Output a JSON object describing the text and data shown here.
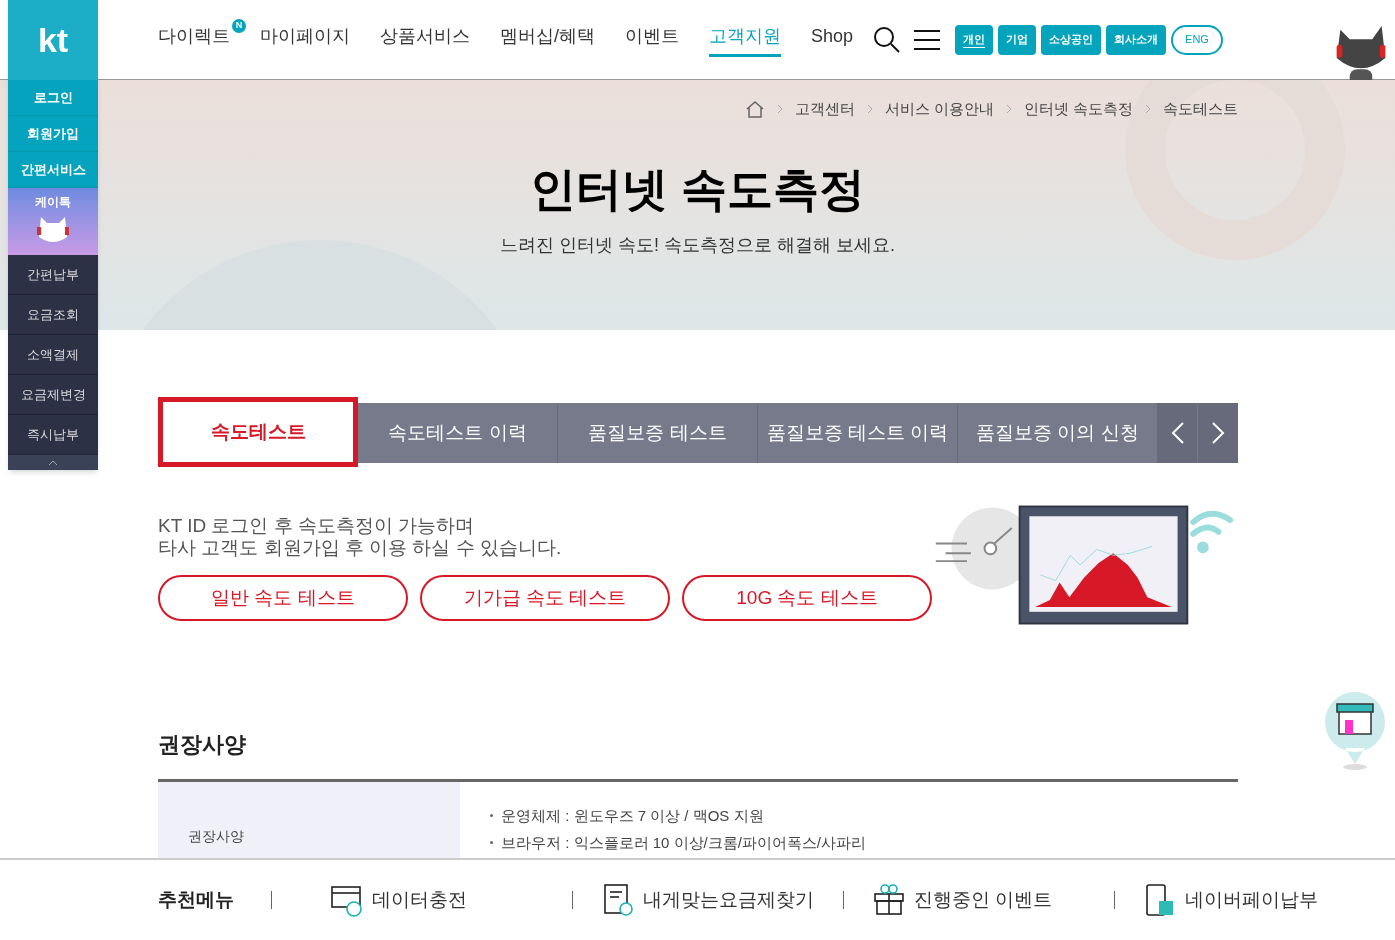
{
  "sidebar": {
    "logo": "kt",
    "top_items": [
      "로그인",
      "회원가입",
      "간편서비스"
    ],
    "chatbot": {
      "label": "케이톡"
    },
    "items": [
      "간편납부",
      "요금조회",
      "소액결제",
      "요금제변경",
      "즉시납부"
    ]
  },
  "nav": {
    "items": [
      {
        "label": "다이렉트",
        "badge": "N",
        "selected": false
      },
      {
        "label": "마이페이지",
        "selected": false
      },
      {
        "label": "상품서비스",
        "selected": false
      },
      {
        "label": "멤버십/혜택",
        "selected": false
      },
      {
        "label": "이벤트",
        "selected": false
      },
      {
        "label": "고객지원",
        "selected": true
      },
      {
        "label": "Shop",
        "selected": false
      }
    ],
    "segments": [
      {
        "label": "개인",
        "kind": "solid",
        "selected": true
      },
      {
        "label": "기업",
        "kind": "solid",
        "selected": false
      },
      {
        "label": "소상공인",
        "kind": "solid",
        "selected": false
      },
      {
        "label": "회사소개",
        "kind": "solid",
        "selected": false
      },
      {
        "label": "ENG",
        "kind": "outline",
        "selected": false
      }
    ]
  },
  "breadcrumb": [
    "고객센터",
    "서비스 이용안내",
    "인터넷 속도측정",
    "속도테스트"
  ],
  "hero": {
    "title": "인터넷 속도측정",
    "subtitle": "느려진 인터넷 속도! 속도측정으로 해결해 보세요."
  },
  "tabs": [
    {
      "label": "속도테스트",
      "selected": true
    },
    {
      "label": "속도테스트 이력",
      "selected": false
    },
    {
      "label": "품질보증 테스트",
      "selected": false
    },
    {
      "label": "품질보증 테스트 이력",
      "selected": false
    },
    {
      "label": "품질보증 이의 신청",
      "selected": false
    }
  ],
  "intro": [
    "KT ID 로그인 후 속도측정이 가능하며",
    "타사 고객도 회원가입 후 이용 하실 수 있습니다."
  ],
  "test_buttons": [
    "일반 속도 테스트",
    "기가급 속도 테스트",
    "10G 속도 테스트"
  ],
  "requirements": {
    "title": "권장사양",
    "header": "권장사양",
    "items": [
      "운영체제 : 윈도우즈 7 이상 / 맥OS 지원",
      "브라우저 : 익스플로러 10 이상/크롬/파이어폭스/사파리"
    ]
  },
  "recommended": {
    "title": "추천메뉴",
    "items": [
      {
        "label": "데이터충전",
        "kind": "card"
      },
      {
        "label": "내게맞는요금제찾기",
        "kind": "bill"
      },
      {
        "label": "진행중인 이벤트",
        "kind": "gift"
      },
      {
        "label": "네이버페이납부",
        "kind": "phone"
      }
    ]
  }
}
